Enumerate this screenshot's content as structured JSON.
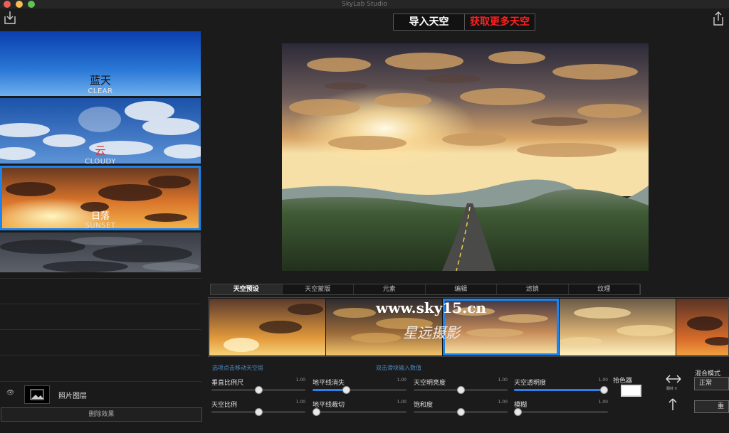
{
  "window": {
    "title": "SkyLab Studio"
  },
  "header": {
    "import_label": "导入天空",
    "more_label": "获取更多天空"
  },
  "presets": [
    {
      "zh": "蓝天",
      "en": "CLEAR"
    },
    {
      "zh": "云",
      "en": "CLOUDY"
    },
    {
      "zh": "日落",
      "en": "SUNSET"
    },
    {
      "zh": "",
      "en": ""
    }
  ],
  "layers": {
    "photo_label": "照片图层",
    "delete_label": "删除效果"
  },
  "tabs": [
    "天空预设",
    "天空蒙版",
    "元素",
    "编辑",
    "滤镜",
    "纹理"
  ],
  "watermark": {
    "url": "www.sky15.cn",
    "script": "星远摄影"
  },
  "hints": {
    "left": "选项点击移动天空层",
    "right": "双击滑块输入数值"
  },
  "sliders": [
    {
      "label": "垂直比例尺",
      "value": "1.00",
      "level": 0.5
    },
    {
      "label": "天空比例",
      "value": "1.00",
      "level": 0.5
    },
    {
      "label": "地平线消失",
      "value": "1.00",
      "level": 0.35
    },
    {
      "label": "地平线裁切",
      "value": "1.00",
      "level": 0.0
    },
    {
      "label": "天空明亮度",
      "value": "1.00",
      "level": 0.5
    },
    {
      "label": "饱和度",
      "value": "1.00",
      "level": 0.5
    },
    {
      "label": "天空透明度",
      "value": "1.00",
      "level": 1.0
    },
    {
      "label": "模糊",
      "value": "1.00",
      "level": 0.0
    }
  ],
  "tools": {
    "picker_label": "拾色器",
    "flip_x_label": "翻转 X",
    "blend_label": "混合模式",
    "blend_value": "正常",
    "reset_label": "重"
  },
  "colors": {
    "accent": "#1a84f0",
    "more": "#ff2020"
  }
}
